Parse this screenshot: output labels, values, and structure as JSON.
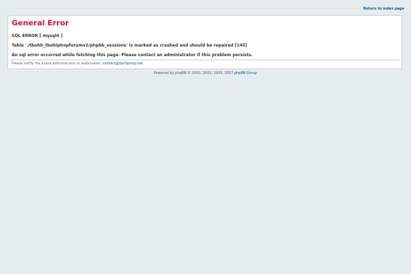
{
  "header": {
    "return_link": "Return to index page"
  },
  "error": {
    "title": "General Error",
    "sql_error": "SQL ERROR [ mysql4 ]",
    "table_message": "Table './tbohh_tbohiphopforumv2/phpbb_sessions' is marked as crashed and should be repaired [145]",
    "help_message": "An sql error occurred while fetching this page. Please contact an administrator if this problem persists."
  },
  "notice": {
    "text": "Please notify the board administrator or webmaster: ",
    "email": "contact@tbohiphop.net"
  },
  "footer": {
    "powered_text": "Powered by phpBB © 2000, 2002, 2005, 2007 ",
    "group_link": "phpBB Group"
  },
  "colors": {
    "background": "#e4ecee",
    "title": "#d31141",
    "link": "#105289"
  }
}
